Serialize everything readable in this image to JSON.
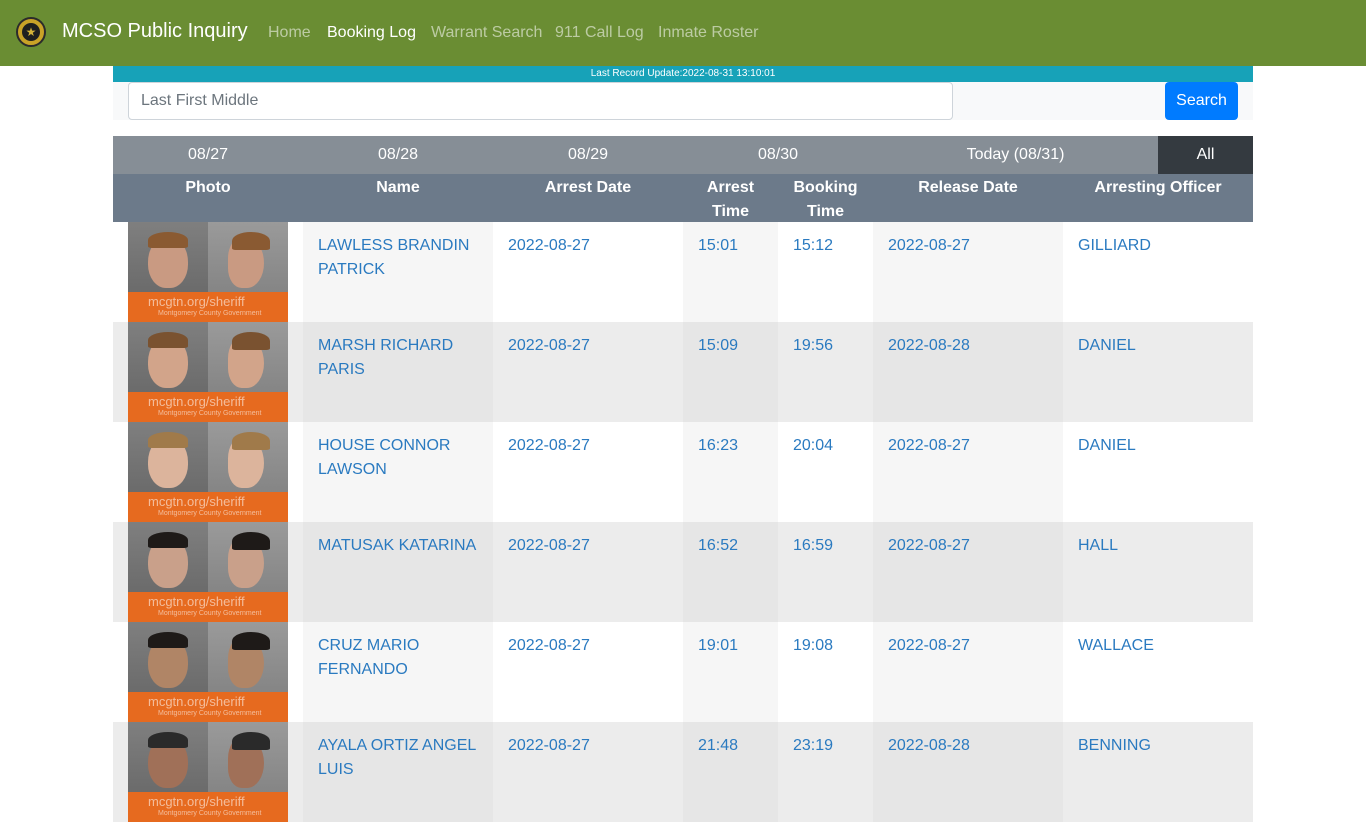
{
  "navbar": {
    "brand": "MCSO Public Inquiry",
    "links": [
      "Home",
      "Booking Log",
      "Warrant Search",
      "911 Call Log",
      "Inmate Roster"
    ],
    "active_link": "Booking Log"
  },
  "update_bar": {
    "text": "Last Record Update:2022-08-31 13:10:01"
  },
  "search": {
    "placeholder": "Last First Middle",
    "value": "",
    "button_label": "Search"
  },
  "date_tabs": [
    "08/27",
    "08/28",
    "08/29",
    "08/30",
    "Today (08/31)",
    "All"
  ],
  "active_tab": "All",
  "table": {
    "headers": {
      "photo": "Photo",
      "name": "Name",
      "arrest_date": "Arrest Date",
      "arrest_time_1": "Arrest",
      "arrest_time_2": "Time",
      "booking_time_1": "Booking",
      "booking_time_2": "Time",
      "release_date": "Release Date",
      "officer": "Arresting Officer"
    },
    "rows": [
      {
        "name_1": "LAWLESS BRANDIN",
        "name_2": "PATRICK",
        "arrest_date": "2022-08-27",
        "arrest_time": "15:01",
        "booking_time": "15:12",
        "release_date": "2022-08-27",
        "officer": "GILLIARD"
      },
      {
        "name_1": "MARSH RICHARD",
        "name_2": "PARIS",
        "arrest_date": "2022-08-27",
        "arrest_time": "15:09",
        "booking_time": "19:56",
        "release_date": "2022-08-28",
        "officer": "DANIEL"
      },
      {
        "name_1": "HOUSE CONNOR",
        "name_2": "LAWSON",
        "arrest_date": "2022-08-27",
        "arrest_time": "16:23",
        "booking_time": "20:04",
        "release_date": "2022-08-27",
        "officer": "DANIEL"
      },
      {
        "name_1": "MATUSAK KATARINA",
        "name_2": "",
        "arrest_date": "2022-08-27",
        "arrest_time": "16:52",
        "booking_time": "16:59",
        "release_date": "2022-08-27",
        "officer": "HALL"
      },
      {
        "name_1": "CRUZ MARIO",
        "name_2": "FERNANDO",
        "arrest_date": "2022-08-27",
        "arrest_time": "19:01",
        "booking_time": "19:08",
        "release_date": "2022-08-27",
        "officer": "WALLACE"
      },
      {
        "name_1": "AYALA ORTIZ ANGEL",
        "name_2": "LUIS",
        "arrest_date": "2022-08-27",
        "arrest_time": "21:48",
        "booking_time": "23:19",
        "release_date": "2022-08-28",
        "officer": "BENNING"
      }
    ]
  },
  "photo_watermark": "mcgtn.org/sheriff",
  "photo_watermark_sub": "Montgomery County Government",
  "colors": {
    "navbar": "#6a8d33",
    "update_bar": "#17a2b8",
    "search_button": "#007bff",
    "tabs": "#868e96",
    "active_tab": "#343a40",
    "table_header": "#6c7a8a",
    "link": "#2a7ac0"
  },
  "icons": {
    "logo": "sheriff-badge-icon"
  }
}
